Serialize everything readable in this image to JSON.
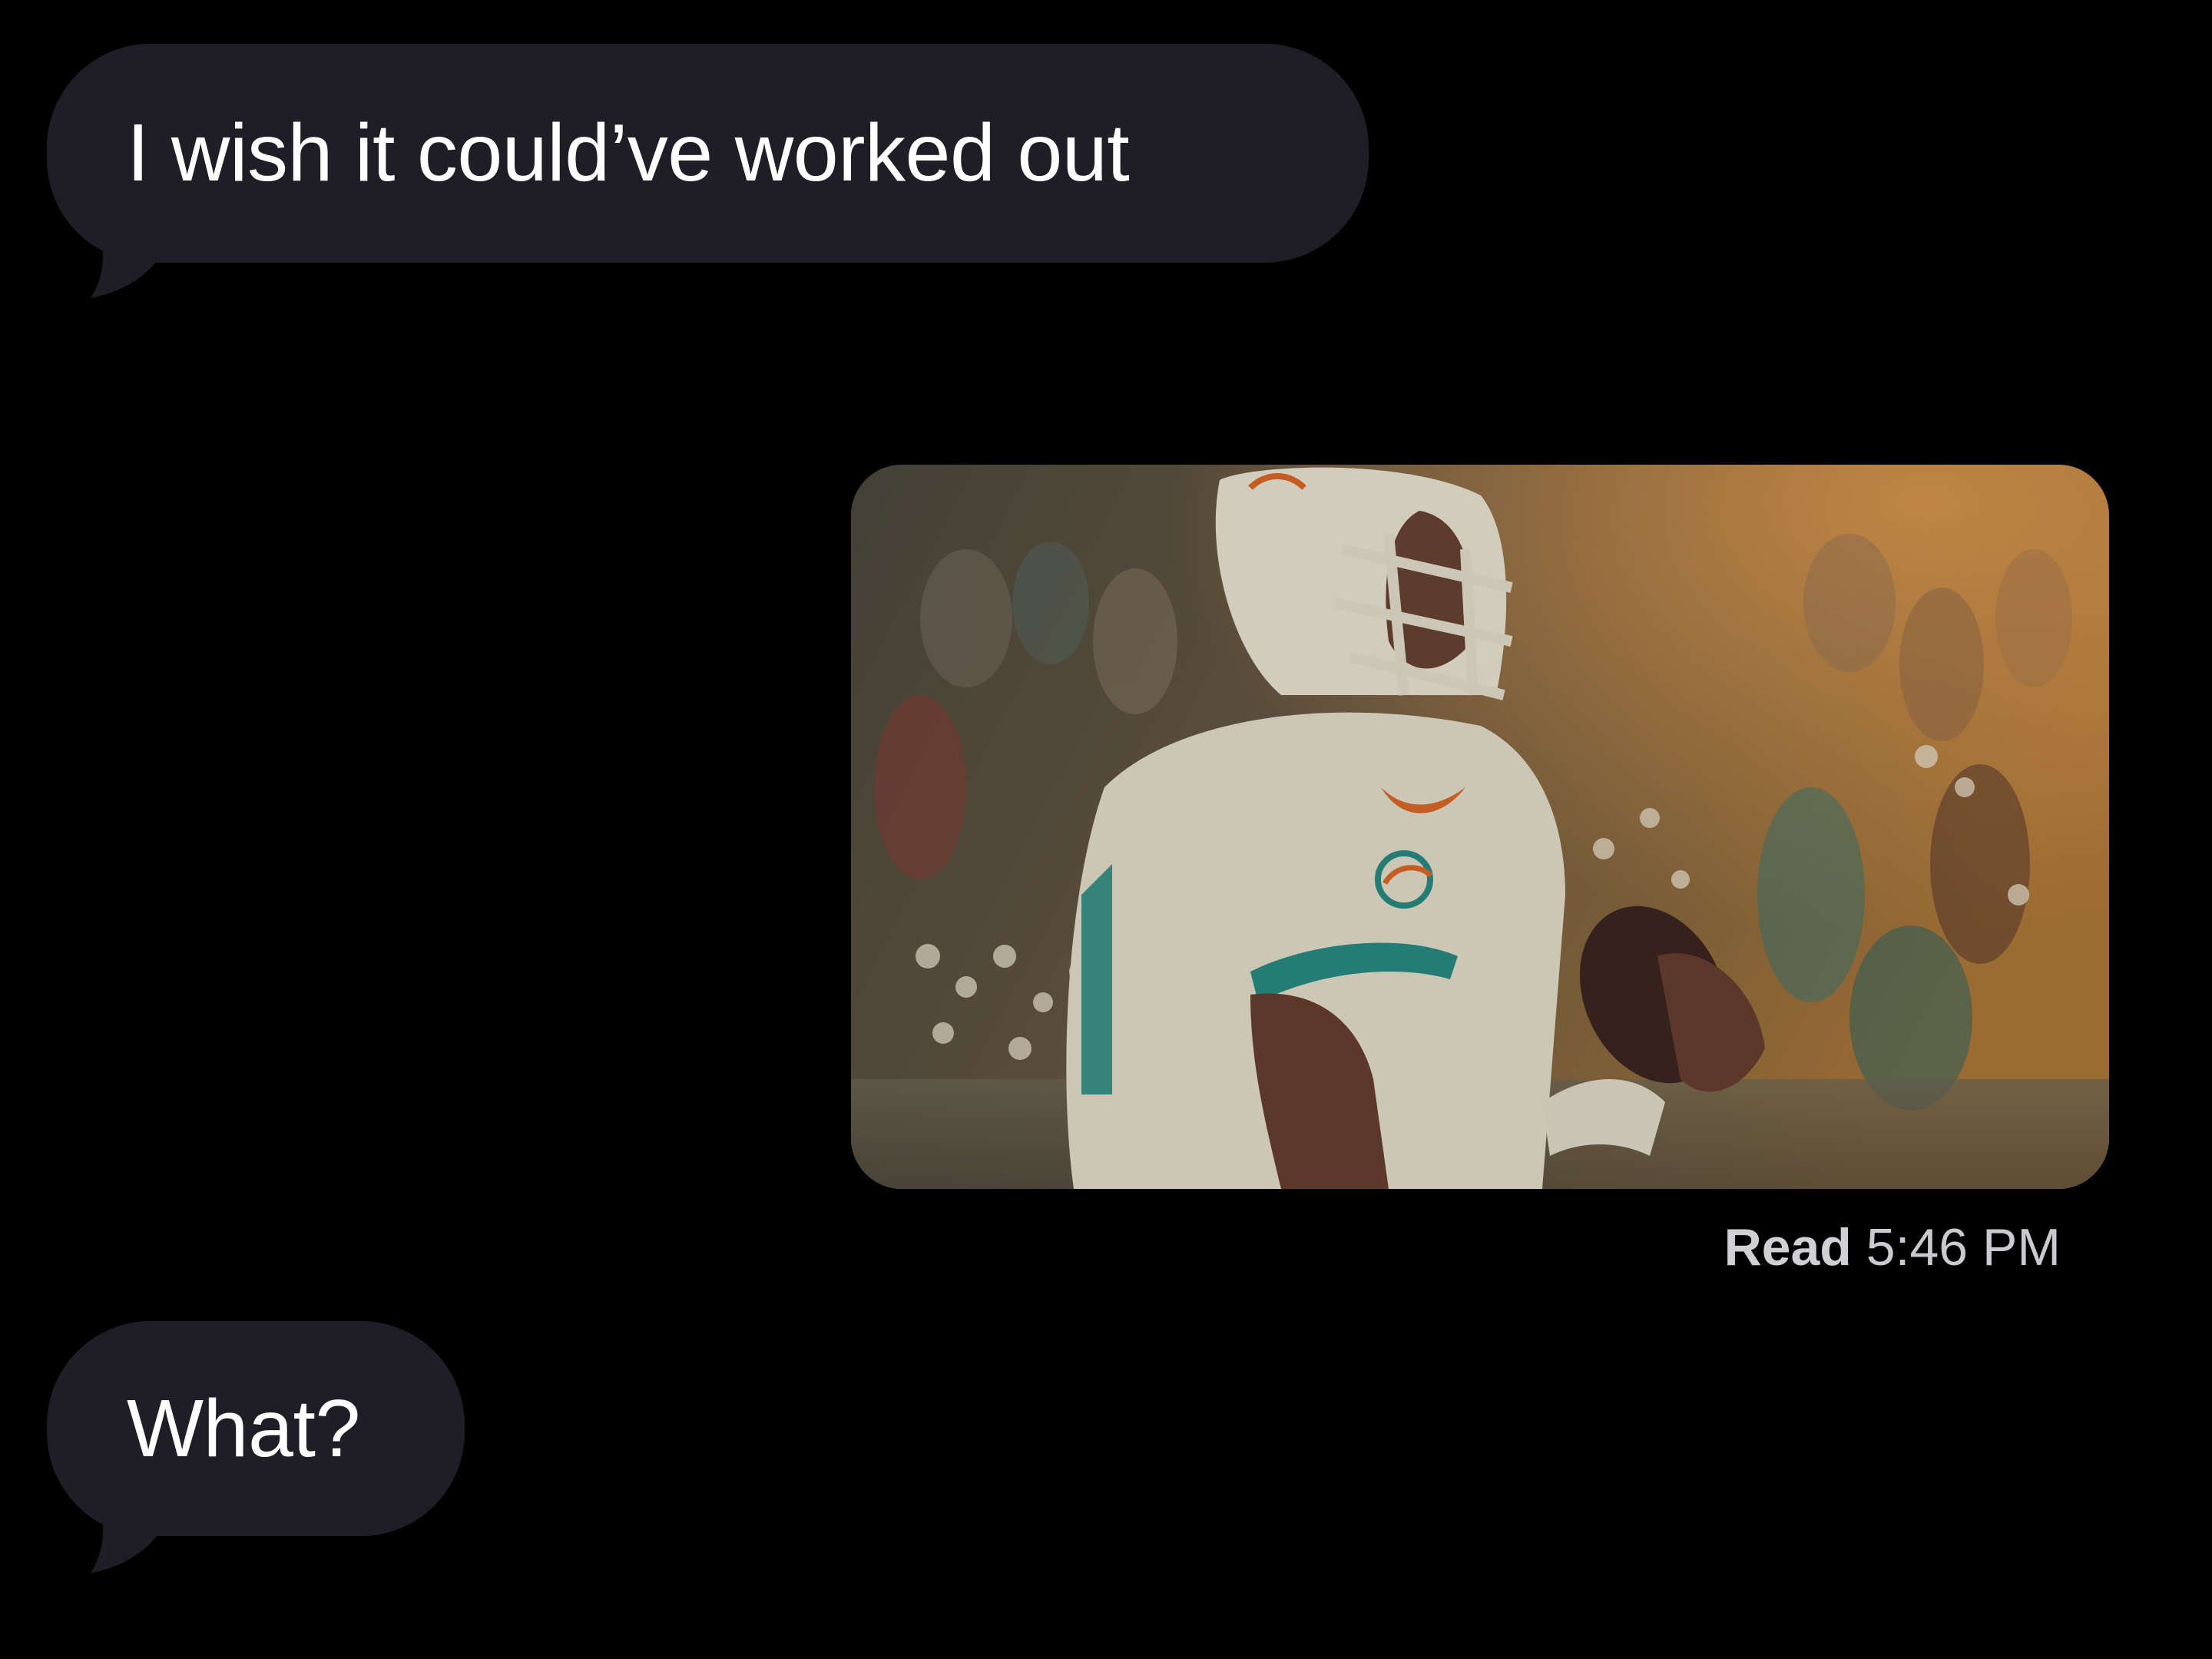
{
  "colors": {
    "background": "#000000",
    "incoming_bubble": "#1f1e26",
    "bubble_text": "#ffffff",
    "receipt_text": "#c9c9cf"
  },
  "messages": {
    "first": {
      "direction": "incoming",
      "text": "I wish it could’ve worked out"
    },
    "second": {
      "direction": "incoming",
      "text": "What?"
    }
  },
  "photo": {
    "direction": "outgoing"
  },
  "receipt": {
    "status": "Read",
    "time": "5:46 PM"
  }
}
